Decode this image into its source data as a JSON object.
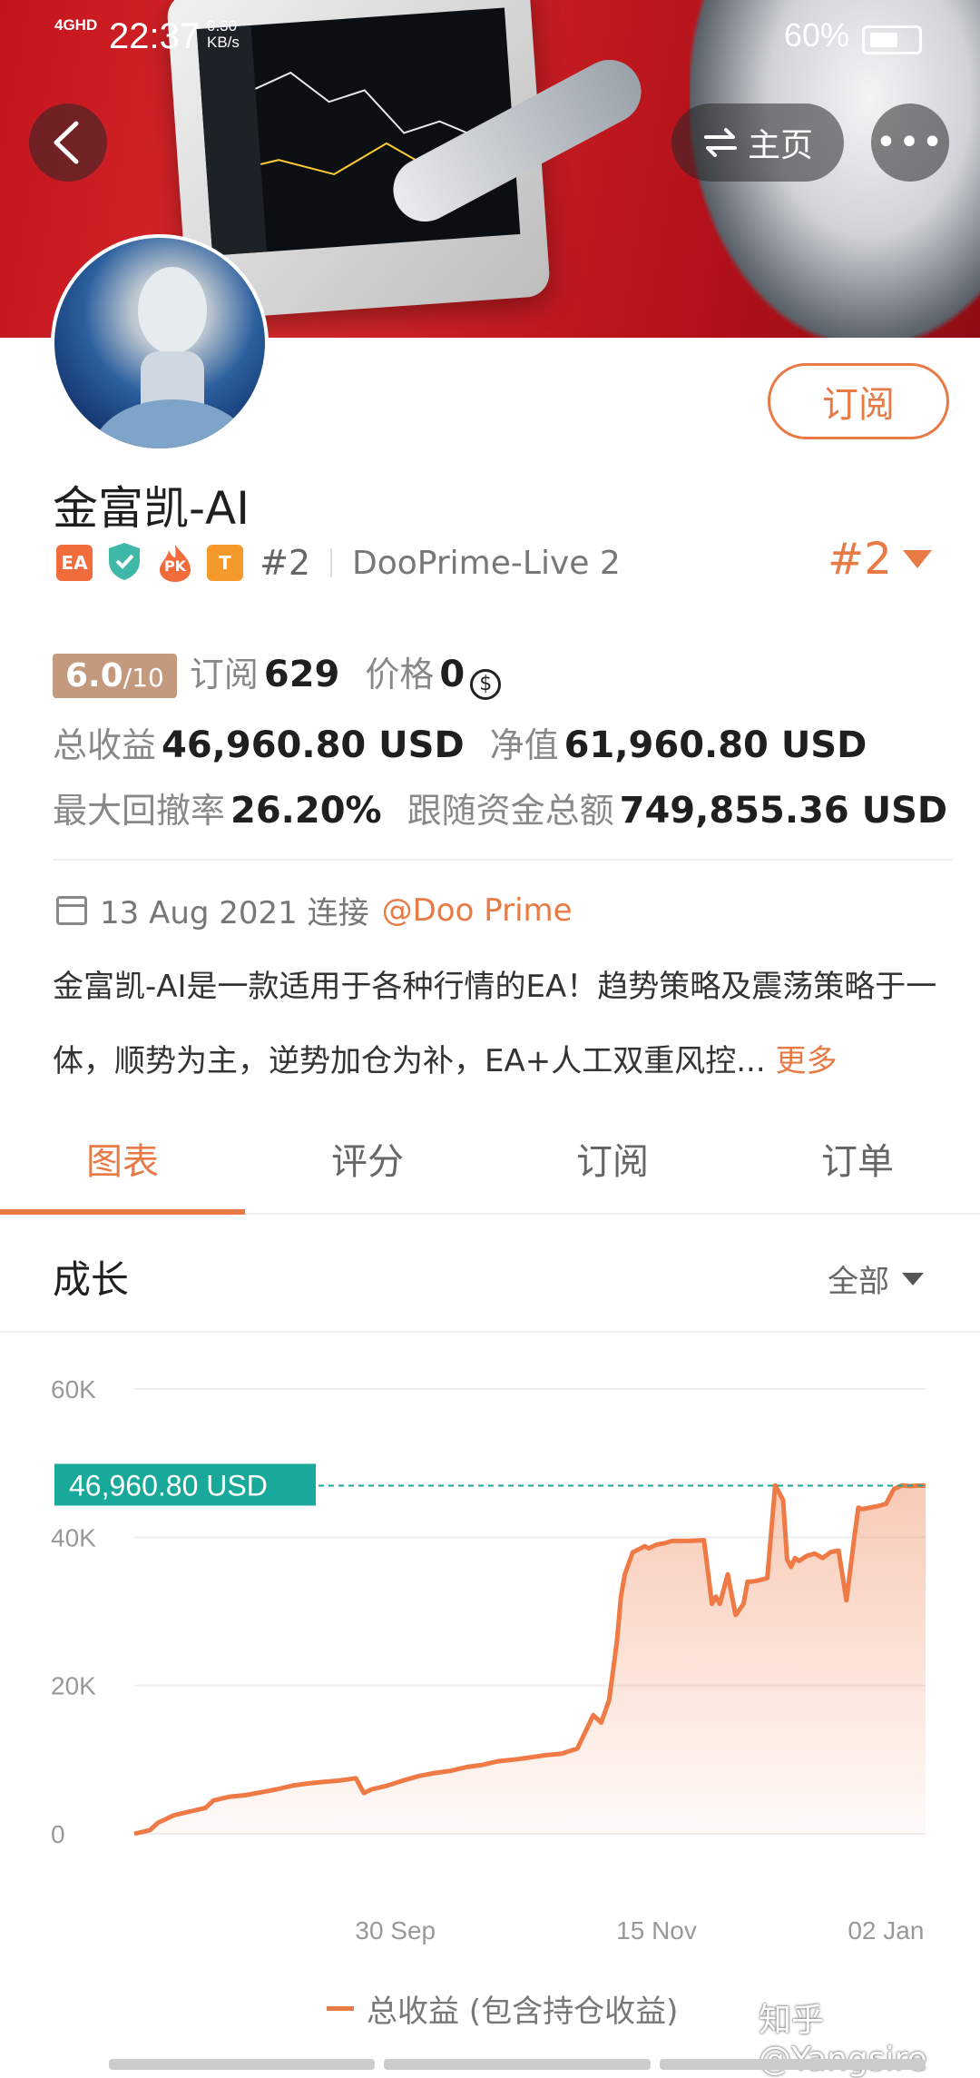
{
  "status_bar": {
    "network": "4GHD",
    "time": "22:37",
    "speed": "0.30 KB/s",
    "battery": "60%"
  },
  "nav": {
    "home_label": "主页",
    "more_label": "•••"
  },
  "profile": {
    "subscribe_label": "订阅",
    "name": "金富凯-AI",
    "badges": [
      {
        "icon": "ea-badge-icon",
        "text": "EA",
        "color": "#f26b3a"
      },
      {
        "icon": "verified-shield-icon",
        "text": "",
        "color": "#3fb8a8"
      },
      {
        "icon": "pk-flame-icon",
        "text": "PK",
        "color": "#f26b3a"
      },
      {
        "icon": "t-badge-icon",
        "text": "T",
        "color": "#f59a2a"
      }
    ],
    "rank": "#2",
    "server": "DooPrime-Live 2",
    "rank_dropdown": "#2"
  },
  "stats": {
    "score": "6.0",
    "score_max": "/10",
    "subscribe_label": "订阅",
    "subscribe_count": "629",
    "price_label": "价格",
    "price_value": "0",
    "price_icon": "coin-icon",
    "total_profit_label": "总收益",
    "total_profit_value": "46,960.80 USD",
    "equity_label": "净值",
    "equity_value": "61,960.80 USD",
    "max_drawdown_label": "最大回撤率",
    "max_drawdown_value": "26.20%",
    "follow_funds_label": "跟随资金总额",
    "follow_funds_value": "749,855.36 USD"
  },
  "connect": {
    "date_text": "13 Aug 2021 连接",
    "broker": "@Doo Prime"
  },
  "description": {
    "text": "金富凯-AI是一款适用于各种行情的EA！趋势策略及震荡策略于一体，顺势为主，逆势加仓为补，EA+人工双重风控...",
    "more_label": "更多"
  },
  "tabs": [
    "图表",
    "评分",
    "订阅",
    "订单"
  ],
  "section": {
    "title": "成长",
    "range": "全部"
  },
  "colors": {
    "accent": "#e87a45",
    "teal": "#18a99a"
  },
  "watermark": "知乎 @Yangsire",
  "chart_data": {
    "type": "area",
    "ylim": [
      0,
      60000
    ],
    "y_ticks": [
      {
        "value": 60000,
        "label": "60K"
      },
      {
        "value": 40000,
        "label": "40K"
      },
      {
        "value": 20000,
        "label": "20K"
      },
      {
        "value": 0,
        "label": "0"
      }
    ],
    "x_ticks": [
      {
        "value": 0.33,
        "label": "30 Sep"
      },
      {
        "value": 0.66,
        "label": "15 Nov"
      },
      {
        "value": 0.95,
        "label": "02 Jan"
      }
    ],
    "current_value_label": "46,960.80 USD",
    "current_value": 46960.8,
    "series": [
      {
        "name": "总收益 (包含持仓收益)",
        "x": [
          0.0,
          0.02,
          0.03,
          0.04,
          0.05,
          0.07,
          0.09,
          0.1,
          0.12,
          0.14,
          0.16,
          0.18,
          0.2,
          0.22,
          0.24,
          0.26,
          0.28,
          0.29,
          0.3,
          0.32,
          0.34,
          0.36,
          0.38,
          0.4,
          0.42,
          0.44,
          0.46,
          0.48,
          0.5,
          0.52,
          0.54,
          0.56,
          0.58,
          0.59,
          0.6,
          0.605,
          0.61,
          0.615,
          0.62,
          0.63,
          0.64,
          0.645,
          0.65,
          0.66,
          0.67,
          0.68,
          0.7,
          0.72,
          0.73,
          0.735,
          0.74,
          0.75,
          0.76,
          0.77,
          0.775,
          0.78,
          0.79,
          0.8,
          0.81,
          0.82,
          0.825,
          0.83,
          0.835,
          0.84,
          0.85,
          0.86,
          0.87,
          0.88,
          0.89,
          0.9,
          0.91,
          0.915,
          0.92,
          0.93,
          0.94,
          0.95,
          0.96,
          0.97,
          0.98,
          0.99,
          1.0
        ],
        "values": [
          0,
          500,
          1500,
          2000,
          2500,
          3000,
          3500,
          4500,
          5000,
          5200,
          5600,
          6000,
          6500,
          6800,
          7000,
          7200,
          7500,
          5500,
          6000,
          6500,
          7200,
          7800,
          8200,
          8500,
          9000,
          9300,
          9800,
          10000,
          10300,
          10600,
          10800,
          11500,
          16000,
          15000,
          18000,
          22000,
          26000,
          32000,
          35000,
          38000,
          38500,
          38800,
          38500,
          39000,
          39200,
          39500,
          39500,
          39600,
          31000,
          32000,
          31000,
          35000,
          29500,
          31000,
          34000,
          34000,
          34200,
          34500,
          47000,
          45000,
          37000,
          36000,
          37200,
          36800,
          37500,
          37800,
          37200,
          38000,
          38200,
          31500,
          40000,
          44000,
          43800,
          44000,
          44200,
          44500,
          46500,
          47000,
          46900,
          46960.8,
          46960.8
        ]
      }
    ]
  }
}
